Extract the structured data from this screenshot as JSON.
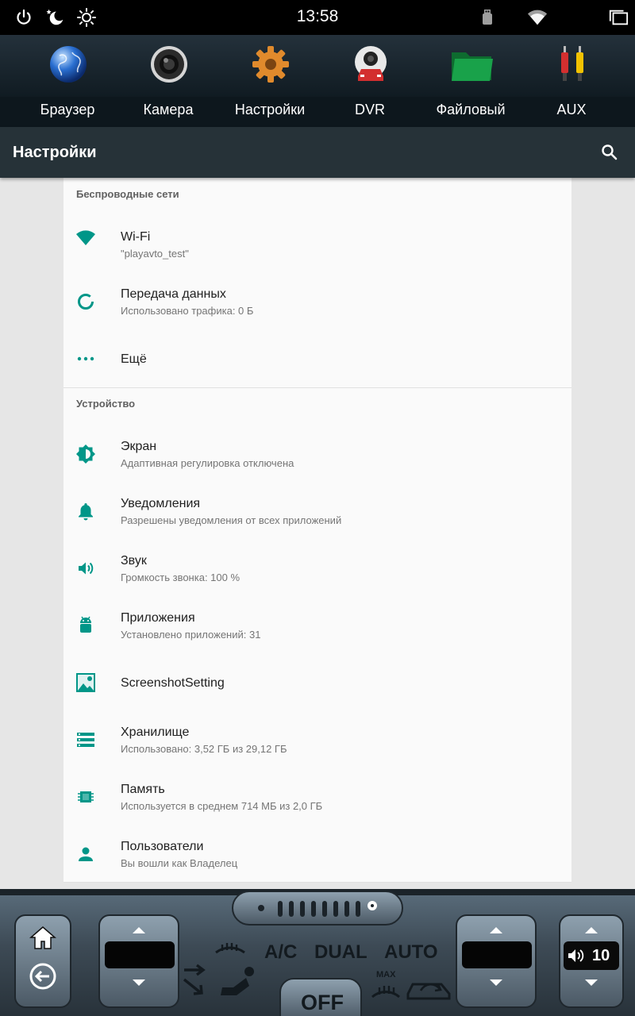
{
  "status_bar": {
    "time": "13:58",
    "icons": [
      "power-icon",
      "night-mode-icon",
      "brightness-icon",
      "usb-icon",
      "wifi-icon",
      "recent-apps-icon"
    ]
  },
  "launcher": {
    "apps": [
      {
        "label": "Браузер",
        "icon": "browser-globe-icon"
      },
      {
        "label": "Камера",
        "icon": "camera-lens-icon"
      },
      {
        "label": "Настройки",
        "icon": "settings-gear-icon"
      },
      {
        "label": "DVR",
        "icon": "dvr-car-icon"
      },
      {
        "label": "Файловый",
        "icon": "folder-icon"
      },
      {
        "label": "AUX",
        "icon": "aux-rca-icon"
      }
    ]
  },
  "action_bar": {
    "title": "Настройки",
    "search_icon": "search-icon"
  },
  "settings": {
    "sections": [
      {
        "header": "Беспроводные сети",
        "items": [
          {
            "title": "Wi-Fi",
            "subtitle": "\"playavto_test\"",
            "icon": "wifi-icon"
          },
          {
            "title": "Передача данных",
            "subtitle": "Использовано трафика: 0 Б",
            "icon": "data-usage-icon"
          },
          {
            "title": "Ещё",
            "subtitle": "",
            "icon": "more-dots-icon"
          }
        ]
      },
      {
        "header": "Устройство",
        "items": [
          {
            "title": "Экран",
            "subtitle": "Адаптивная регулировка отключена",
            "icon": "display-brightness-icon"
          },
          {
            "title": "Уведомления",
            "subtitle": "Разрешены уведомления от всех приложений",
            "icon": "bell-icon"
          },
          {
            "title": "Звук",
            "subtitle": "Громкость звонка: 100 %",
            "icon": "volume-icon"
          },
          {
            "title": "Приложения",
            "subtitle": "Установлено приложений: 31",
            "icon": "android-icon"
          },
          {
            "title": "ScreenshotSetting",
            "subtitle": "",
            "icon": "screenshot-icon"
          },
          {
            "title": "Хранилище",
            "subtitle": "Использовано: 3,52 ГБ из 29,12 ГБ",
            "icon": "storage-icon"
          },
          {
            "title": "Память",
            "subtitle": "Используется в среднем 714 МБ из 2,0 ГБ",
            "icon": "memory-chip-icon"
          },
          {
            "title": "Пользователи",
            "subtitle": "Вы вошли как Владелец",
            "icon": "person-icon"
          }
        ]
      }
    ]
  },
  "climate": {
    "ac_label": "A/C",
    "dual_label": "DUAL",
    "auto_label": "AUTO",
    "off_label": "OFF",
    "max_label": "MAX",
    "volume_value": "10"
  },
  "colors": {
    "accent": "#009688",
    "action_bar": "#263238",
    "status_bar": "#000000"
  }
}
